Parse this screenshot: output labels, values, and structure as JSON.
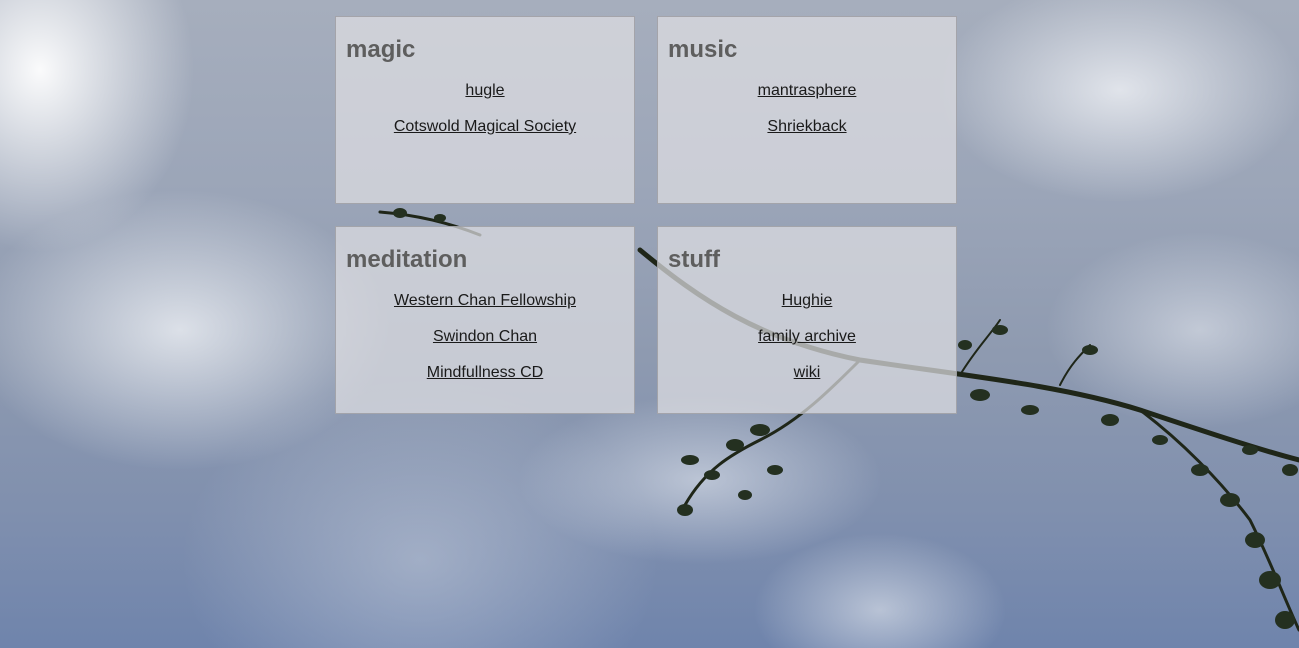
{
  "panels": [
    {
      "title": "magic",
      "links": [
        "hugle",
        "Cotswold Magical Society"
      ]
    },
    {
      "title": "music",
      "links": [
        "mantrasphere",
        "Shriekback"
      ]
    },
    {
      "title": "meditation",
      "links": [
        "Western Chan Fellowship",
        "Swindon Chan",
        "Mindfullness CD"
      ]
    },
    {
      "title": "stuff",
      "links": [
        "Hughie",
        "family archive",
        "wiki"
      ]
    }
  ]
}
